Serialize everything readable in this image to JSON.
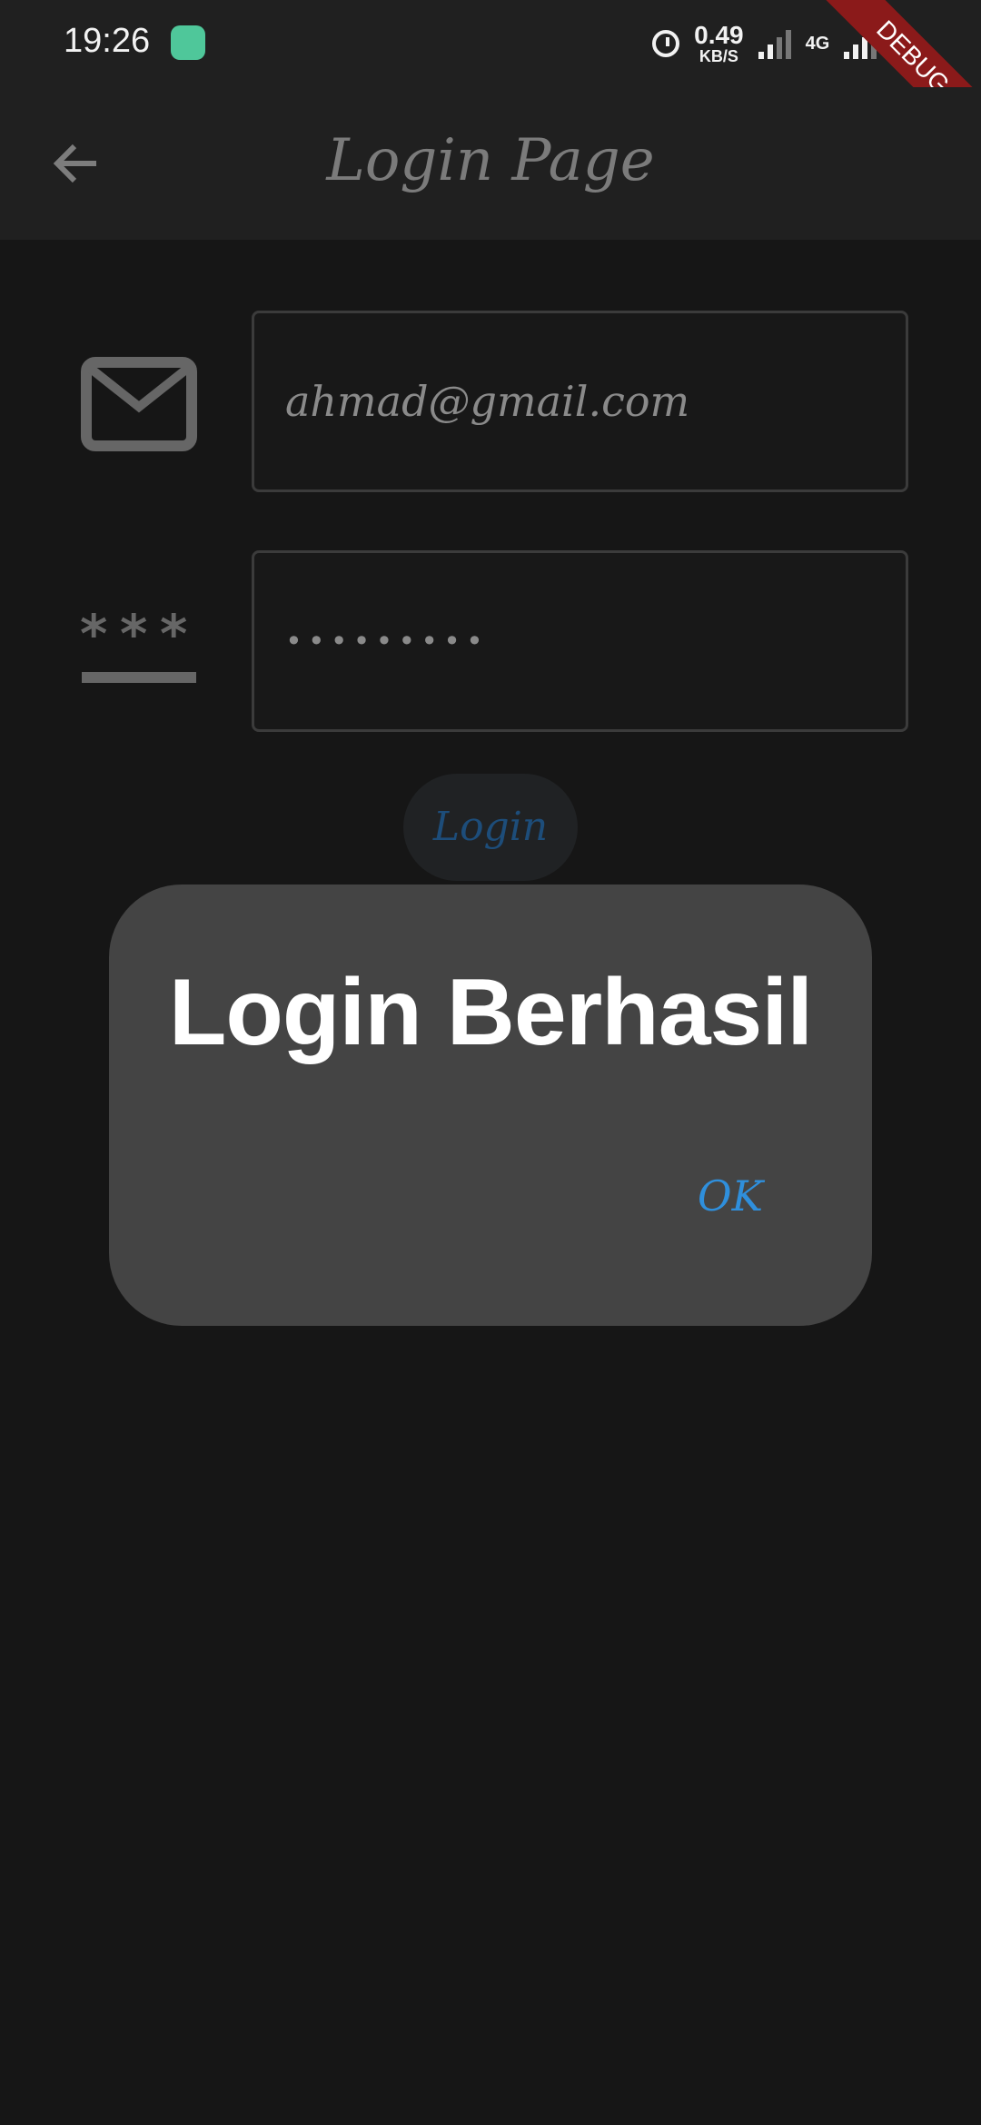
{
  "status_bar": {
    "time": "19:26",
    "speed_value": "0.49",
    "speed_unit": "KB/S",
    "network_1": "4G",
    "network_2": "4G"
  },
  "debug_banner": "DEBUG",
  "app_bar": {
    "title": "Login Page"
  },
  "form": {
    "email_value": "ahmad@gmail.com",
    "password_value": "•••••••••"
  },
  "login_button": "Login",
  "dialog": {
    "title": "Login Berhasil",
    "ok_label": "OK"
  },
  "colors": {
    "accent": "#2f8fdc",
    "dialog_bg": "#444444",
    "background": "#161616"
  }
}
